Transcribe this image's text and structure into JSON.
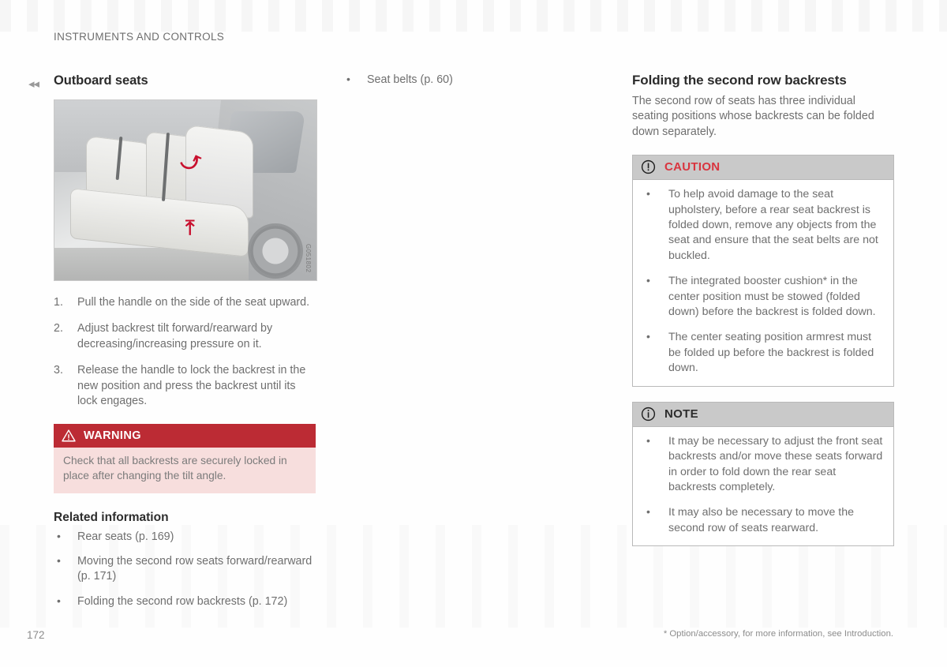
{
  "page": {
    "running_head": "INSTRUMENTS AND CONTROLS",
    "page_number": "172",
    "footnote": "* Option/accessory, for more information, see Introduction.",
    "back_arrows": "◂◂"
  },
  "colors": {
    "warning_header_bg": "#bc2b34",
    "warning_body_bg": "#f7dedd",
    "caution_title": "#d9353f",
    "infobox_header_bg": "#c9c9c9",
    "body_text": "#6f6f6f",
    "heading_text": "#2b2b2b",
    "arrow_red": "#c8102e"
  },
  "column_left": {
    "title": "Outboard seats",
    "figure": {
      "alt": "Rear seat outboard seat backrest adjustment illustration",
      "image_id": "G051802"
    },
    "steps": [
      "Pull the handle on the side of the seat upward.",
      "Adjust backrest tilt forward/rearward by decreasing/increasing pressure on it.",
      "Release the handle to lock the backrest in the new position and press the backrest until its lock engages."
    ],
    "warning": {
      "icon": "warning-triangle-icon",
      "title": "WARNING",
      "body": "Check that all backrests are securely locked in place after changing the tilt angle."
    },
    "related_information": {
      "title": "Related information",
      "items": [
        "Rear seats (p. 169)",
        "Moving the second row seats forward/rearward (p. 171)",
        "Folding the second row backrests (p. 172)"
      ]
    }
  },
  "column_middle": {
    "items": [
      "Seat belts (p. 60)"
    ]
  },
  "column_right": {
    "title": "Folding the second row backrests",
    "intro": "The second row of seats has three individual seating positions whose backrests can be folded down separately.",
    "caution": {
      "icon": "exclamation-circle-icon",
      "title": "CAUTION",
      "items": [
        "To help avoid damage to the seat upholstery, before a rear seat backrest is folded down, remove any objects from the seat and ensure that the seat belts are not buckled.",
        "The integrated booster cushion* in the center position must be stowed (folded down) before the backrest is folded down.",
        "The center seating position armrest must be folded up before the backrest is folded down."
      ]
    },
    "note": {
      "icon": "info-circle-icon",
      "title": "NOTE",
      "items": [
        "It may be necessary to adjust the front seat backrests and/or move these seats forward in order to fold down the rear seat backrests completely.",
        "It may also be necessary to move the second row of seats rearward."
      ]
    }
  }
}
